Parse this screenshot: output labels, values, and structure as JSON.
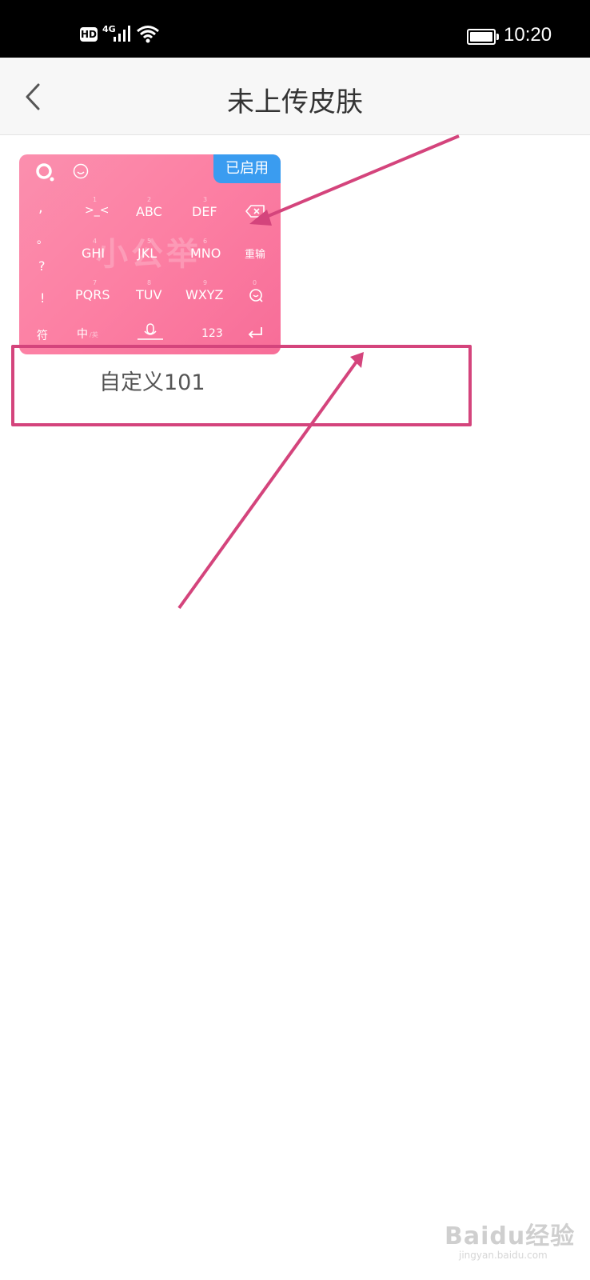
{
  "status_bar": {
    "hd": "HD",
    "network": "4G",
    "time": "10:20",
    "icons": [
      "signal-icon",
      "wifi-icon",
      "battery-icon"
    ]
  },
  "header": {
    "title": "未上传皮肤",
    "back_icon": "chevron-left-icon"
  },
  "skin": {
    "badge": "已启用",
    "name": "自定义101",
    "watermark": "小公举",
    "keyboard": {
      "top_icons": [
        "logo-icon",
        "emoji-icon"
      ],
      "left_column": [
        ",",
        "。",
        "?",
        "!"
      ],
      "row1": [
        ">_<",
        "ABC",
        "DEF"
      ],
      "row2": [
        "GHI",
        "JKL",
        "MNO"
      ],
      "row3": [
        "PQRS",
        "TUV",
        "WXYZ"
      ],
      "row1_numbers": [
        "1",
        "2",
        "3"
      ],
      "row2_numbers": [
        "4",
        "5",
        "6"
      ],
      "row3_numbers": [
        "7",
        "8",
        "9"
      ],
      "right_numbers": [
        "0"
      ],
      "right_column": [
        "delete-icon",
        "重输",
        "search-icon"
      ],
      "bottom_row": {
        "symbols": "符",
        "chinese": "中",
        "chinese_alt": "/英",
        "mic_icon": "microphone-icon",
        "numbers": "123",
        "enter_icon": "enter-icon"
      }
    }
  },
  "watermark": {
    "brand": "Baidu经验",
    "url": "jingyan.baidu.com"
  },
  "colors": {
    "annotation": "#d4447c",
    "badge": "#3a9cf0",
    "skin_pink": "#fc7fa3"
  }
}
